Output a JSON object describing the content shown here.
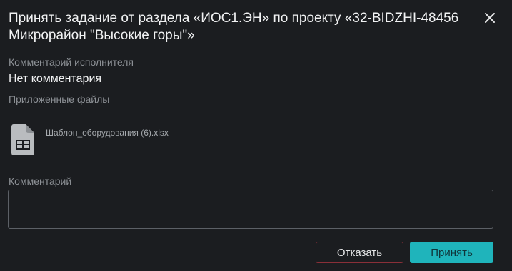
{
  "dialog": {
    "title": "Принять задание от раздела «ИОС1.ЭН» по проекту «32-BIDZHI-48456 Микрорайон \"Высокие горы\"»",
    "close_icon": "close-icon"
  },
  "executor_comment": {
    "label": "Комментарий исполнителя",
    "value": "Нет комментария"
  },
  "attachments": {
    "label": "Приложенные файлы",
    "files": [
      {
        "name": "Шаблон_оборудования (6).xlsx",
        "icon": "spreadsheet-file-icon"
      }
    ]
  },
  "comment": {
    "label": "Комментарий",
    "value": "",
    "placeholder": ""
  },
  "actions": {
    "reject_label": "Отказать",
    "accept_label": "Принять"
  },
  "colors": {
    "background": "#1b1d20",
    "accent": "#1fb4bb",
    "reject_border": "#8a2f38"
  }
}
